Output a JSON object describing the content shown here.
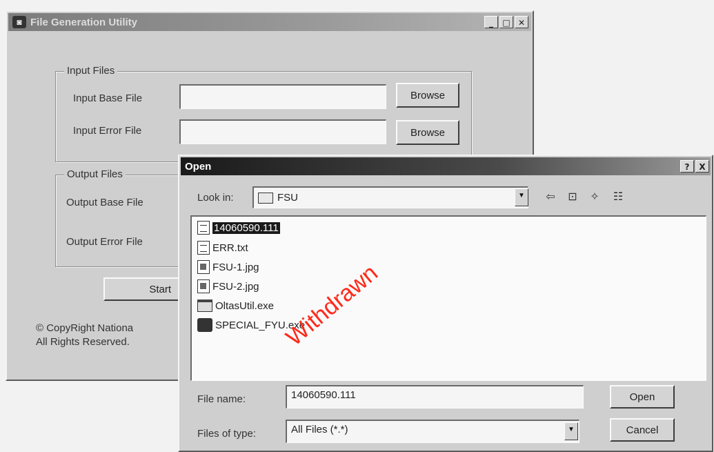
{
  "util_window": {
    "title": "File Generation Utility",
    "input_group": {
      "label": "Input Files",
      "base_label": "Input Base File",
      "error_label": "Input Error File",
      "base_value": "",
      "error_value": "",
      "browse1": "Browse",
      "browse2": "Browse"
    },
    "output_group": {
      "label": "Output Files",
      "base_label": "Output Base File",
      "error_label": "Output Error File"
    },
    "start_button": "Start",
    "copyright_line1": "© CopyRight Nationa",
    "copyright_line2": "All Rights Reserved."
  },
  "open_dialog": {
    "title": "Open",
    "help_button": "?",
    "close_button": "X",
    "look_in_label": "Look in:",
    "look_in_value": "FSU",
    "files": [
      {
        "name": "14060590.111",
        "icon": "text-file-icon",
        "selected": true
      },
      {
        "name": "ERR.txt",
        "icon": "text-file-icon",
        "selected": false
      },
      {
        "name": "FSU-1.jpg",
        "icon": "image-file-icon",
        "selected": false
      },
      {
        "name": "FSU-2.jpg",
        "icon": "image-file-icon",
        "selected": false
      },
      {
        "name": "OltasUtil.exe",
        "icon": "exe-file-icon",
        "selected": false
      },
      {
        "name": "SPECIAL_FYU.exe",
        "icon": "app-exe-icon",
        "selected": false
      }
    ],
    "file_name_label": "File name:",
    "file_name_value": "14060590.111",
    "files_of_type_label": "Files of type:",
    "files_of_type_value": "All Files (*.*)",
    "open_button": "Open",
    "cancel_button": "Cancel"
  },
  "watermark": "Withdrawn"
}
